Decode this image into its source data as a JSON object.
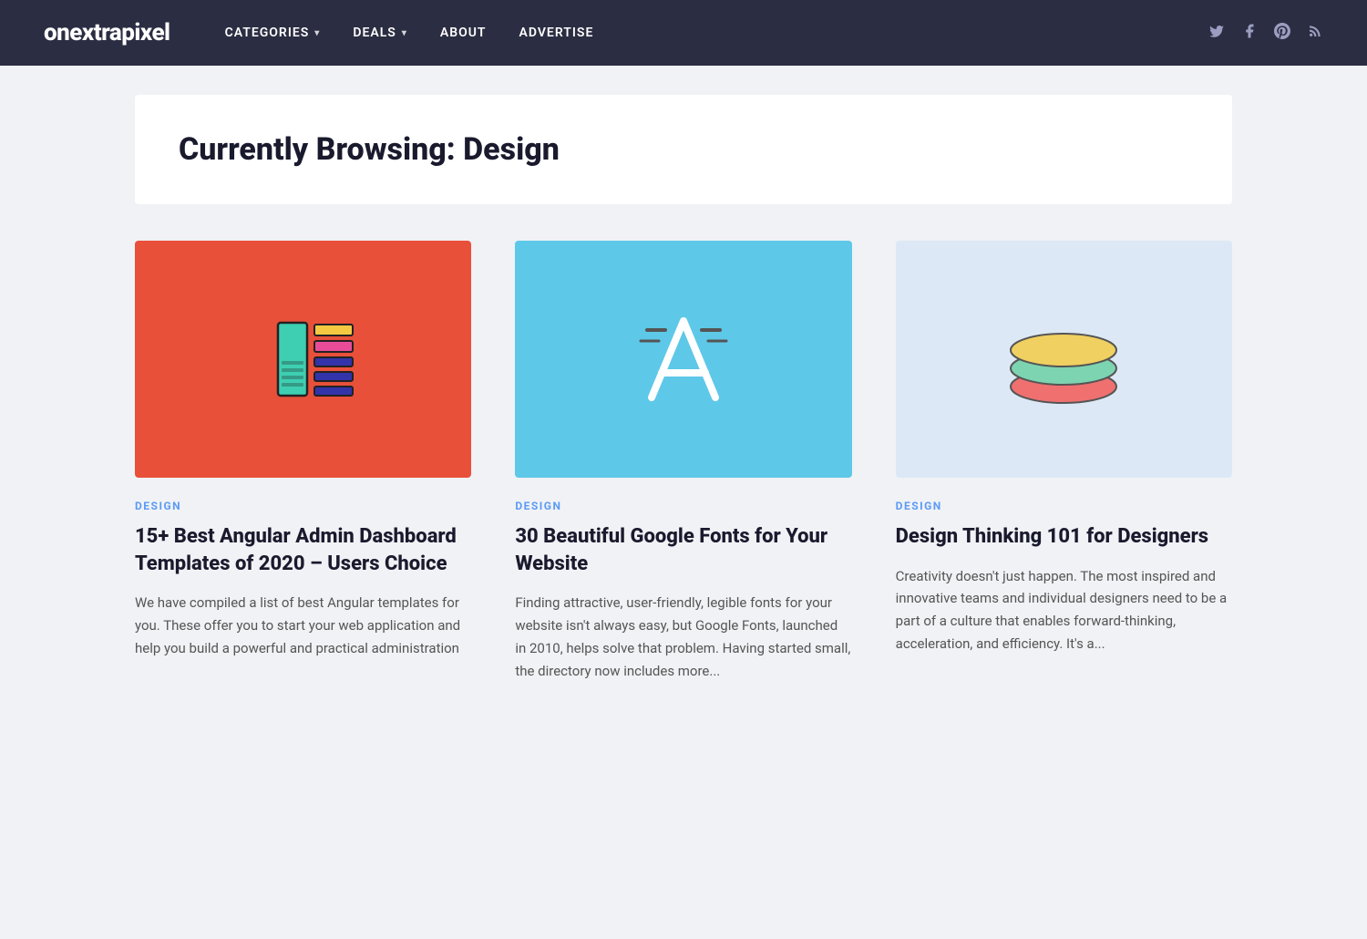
{
  "site": {
    "logo": "onextrapixel"
  },
  "nav": {
    "links": [
      {
        "label": "CATEGORIES",
        "id": "categories",
        "hasDropdown": true
      },
      {
        "label": "DEALS",
        "id": "deals",
        "hasDropdown": true
      },
      {
        "label": "ABOUT",
        "id": "about",
        "hasDropdown": false
      },
      {
        "label": "ADVERTISE",
        "id": "advertise",
        "hasDropdown": false
      }
    ],
    "social": [
      {
        "label": "Twitter",
        "id": "twitter",
        "icon": "𝕏"
      },
      {
        "label": "Facebook",
        "id": "facebook",
        "icon": "f"
      },
      {
        "label": "Pinterest",
        "id": "pinterest",
        "icon": "𝗣"
      },
      {
        "label": "RSS",
        "id": "rss",
        "icon": "⌘"
      }
    ]
  },
  "page": {
    "browsing_prefix": "Currently Browsing:",
    "browsing_category": "Design"
  },
  "articles": [
    {
      "id": "article-1",
      "category": "DESIGN",
      "title": "15+ Best Angular Admin Dashboard Templates of 2020 – Users Choice",
      "excerpt": "We have compiled a list of best Angular templates for you. These offer you to start your web application and help you build a powerful and practical administration",
      "thumb_type": "red"
    },
    {
      "id": "article-2",
      "category": "DESIGN",
      "title": "30 Beautiful Google Fonts for Your Website",
      "excerpt": "Finding attractive, user-friendly, legible fonts for your website isn't always easy, but Google Fonts, launched in 2010, helps solve that problem. Having started small, the directory now includes more...",
      "thumb_type": "blue"
    },
    {
      "id": "article-3",
      "category": "DESIGN",
      "title": "Design Thinking 101 for Designers",
      "excerpt": "Creativity doesn't just happen. The most inspired and innovative teams and individual designers need to be a part of a culture that enables forward-thinking, acceleration, and efficiency. It's a...",
      "thumb_type": "lightblue"
    }
  ]
}
